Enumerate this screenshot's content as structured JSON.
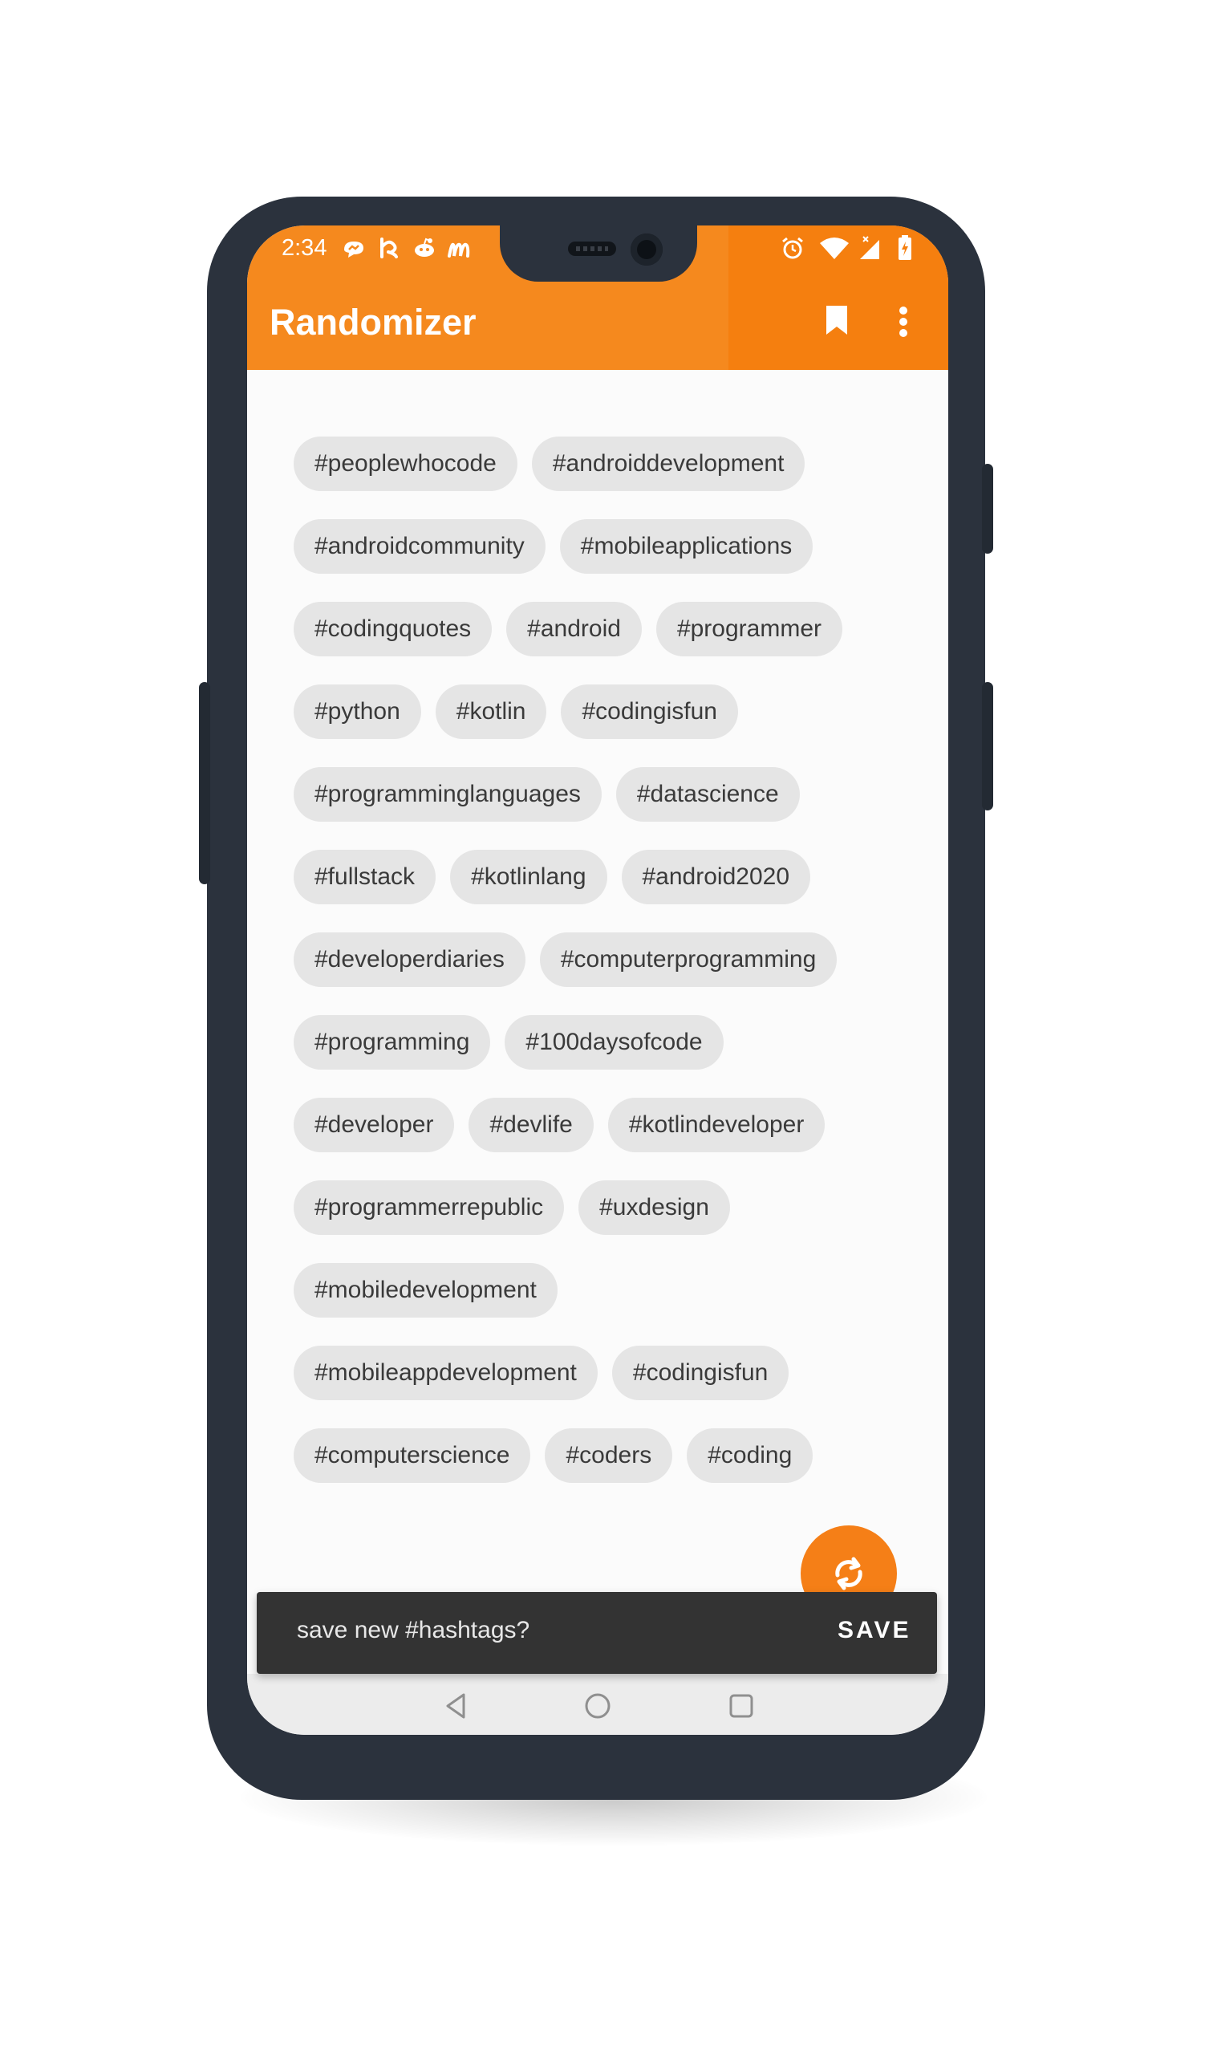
{
  "status_bar": {
    "time": "2:34",
    "notification_icons": [
      "messenger-icon",
      "app-icon",
      "reddit-icon",
      "m-app-icon"
    ],
    "system_icons": [
      "alarm-icon",
      "wifi-icon",
      "signal-icon",
      "battery-icon"
    ]
  },
  "toolbar": {
    "title": "Randomizer",
    "bookmark_icon": "bookmark-icon",
    "overflow_icon": "more-vert-icon"
  },
  "colors": {
    "primary": "#f5891e",
    "accent": "#f57f17",
    "chip_background": "#e5e5e5",
    "snackbar_background": "#333333"
  },
  "hashtag_rows": [
    [
      "#peoplewhocode",
      "#androiddevelopment"
    ],
    [
      "#androidcommunity",
      "#mobileapplications"
    ],
    [
      "#codingquotes",
      "#android",
      "#programmer"
    ],
    [
      "#python",
      "#kotlin",
      "#codingisfun"
    ],
    [
      "#programminglanguages",
      "#datascience"
    ],
    [
      "#fullstack",
      "#kotlinlang",
      "#android2020"
    ],
    [
      "#developerdiaries",
      "#computerprogramming"
    ],
    [
      "#programming",
      "#100daysofcode"
    ],
    [
      "#developer",
      "#devlife",
      "#kotlindeveloper"
    ],
    [
      "#programmerrepublic",
      "#uxdesign"
    ],
    [
      "#mobiledevelopment"
    ],
    [
      "#mobileappdevelopment",
      "#codingisfun"
    ],
    [
      "#computerscience",
      "#coders",
      "#coding"
    ]
  ],
  "fab": {
    "icon": "refresh-icon"
  },
  "snackbar": {
    "message": "save new #hashtags?",
    "action": "SAVE"
  },
  "nav_bar": {
    "icons": [
      "back-icon",
      "home-icon",
      "recents-icon"
    ]
  }
}
